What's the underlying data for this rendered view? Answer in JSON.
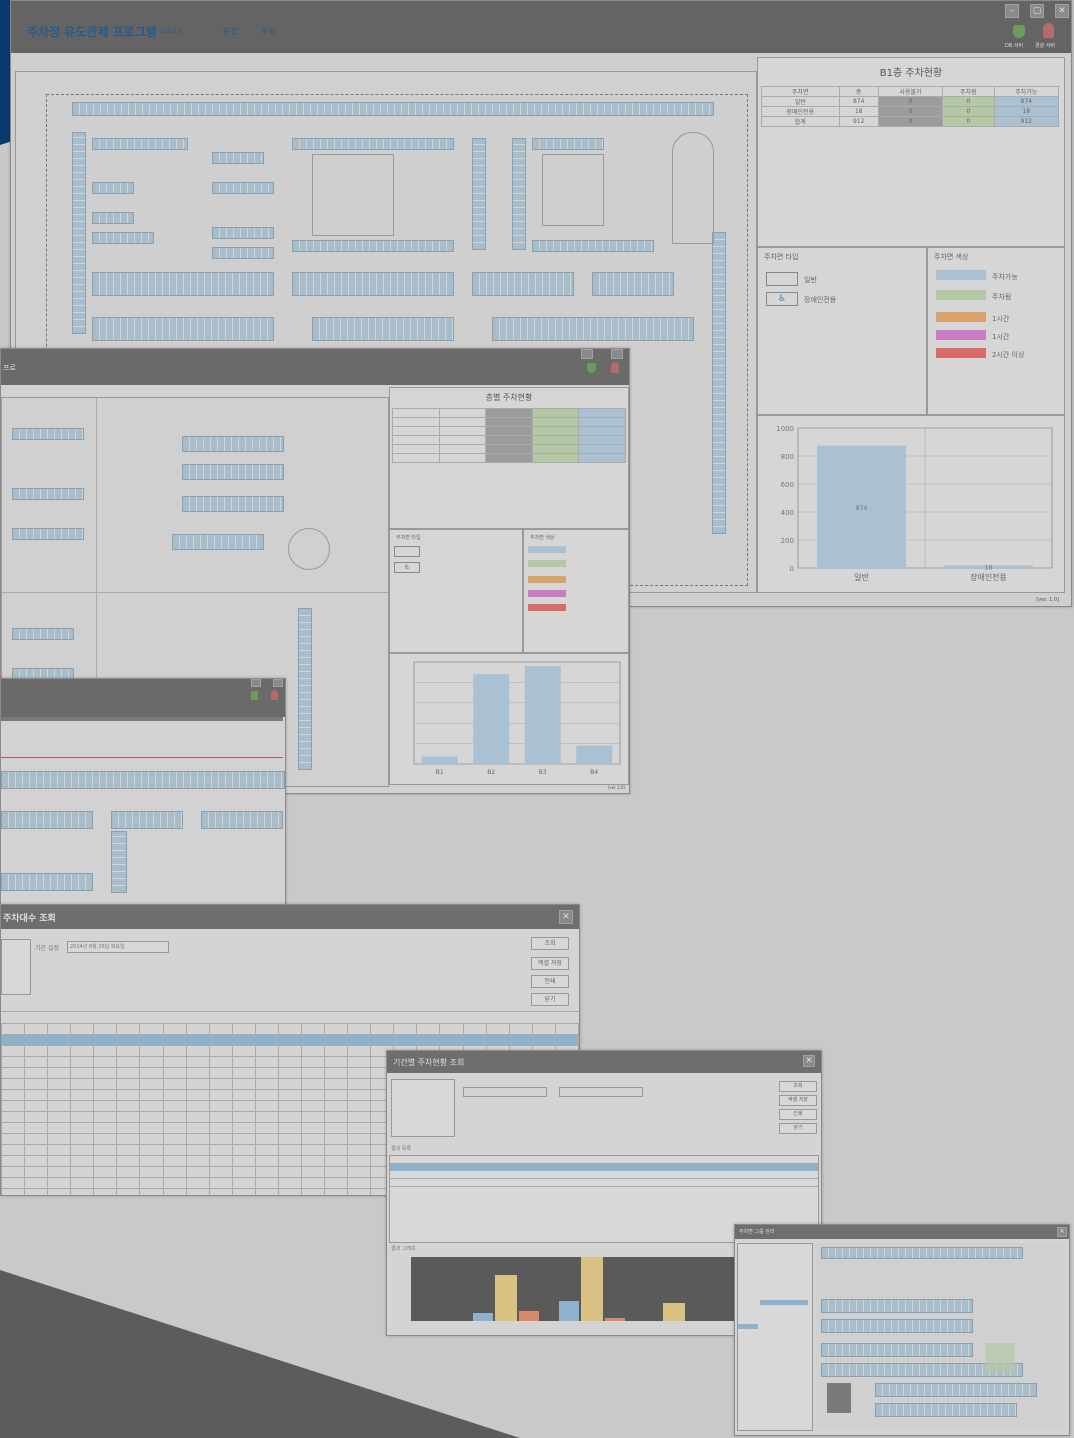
{
  "main_window": {
    "title": "주차장 유도관제 프로그램",
    "version": "v3.0.0",
    "menu": [
      "통합",
      "조회"
    ],
    "tray": [
      "DB 서버",
      "경광 서버"
    ],
    "status": "[ver. 1.0]"
  },
  "b1_status": {
    "title": "B1층 주차현황",
    "headers": [
      "주차면",
      "총",
      "사용불가",
      "주차됨",
      "주차가능"
    ],
    "rows": [
      [
        "일반",
        "874",
        "0",
        "0",
        "874"
      ],
      [
        "장애인전용",
        "18",
        "0",
        "0",
        "18"
      ],
      [
        "합계",
        "912",
        "0",
        "0",
        "912"
      ]
    ]
  },
  "legend_left": {
    "title": "주차면 타입",
    "items": [
      "일반",
      "장애인전용"
    ]
  },
  "legend_right": {
    "title": "주차면 색상",
    "items": [
      {
        "label": "주차가능",
        "color": "#a9c1d2"
      },
      {
        "label": "주차됨",
        "color": "#b4c8a6"
      },
      {
        "label": "1시간",
        "color": "#d9a46a"
      },
      {
        "label": "1시간",
        "color": "#c97bc4"
      },
      {
        "label": "2시간 이상",
        "color": "#d96a6a"
      }
    ]
  },
  "b1_chart": {
    "chart_data": {
      "type": "bar",
      "categories": [
        "일반",
        "장애인전용"
      ],
      "values": [
        874,
        18
      ],
      "yticks": [
        "1000",
        "800",
        "600",
        "400",
        "200",
        "0"
      ],
      "ylim": [
        0,
        1000
      ]
    }
  },
  "floor_window": {
    "title": "층별 주차현황",
    "legend_left_title": "주차면 타입",
    "legend_right_title": "주차면 색상",
    "status": "[ver 1.0]",
    "chart_data": {
      "type": "bar",
      "categories": [
        "B1",
        "B2",
        "B3",
        "B4"
      ],
      "values": [
        18,
        220,
        240,
        45
      ],
      "ylim": [
        0,
        250
      ]
    }
  },
  "search_window": {
    "title": "주차대수 조회",
    "label": "기간 설정",
    "date": "2014년 8월 26일 화요일",
    "buttons": [
      "조회",
      "엑셀 저장",
      "인쇄",
      "닫기"
    ]
  },
  "period_window": {
    "title": "기간별 주차현황 조회",
    "section1": "결과 목록",
    "section2": "결과 그래프",
    "buttons": [
      "조회",
      "엑셀 저장",
      "인쇄",
      "닫기"
    ]
  },
  "thumb_window": {
    "title": "주차면 그룹 관리"
  }
}
